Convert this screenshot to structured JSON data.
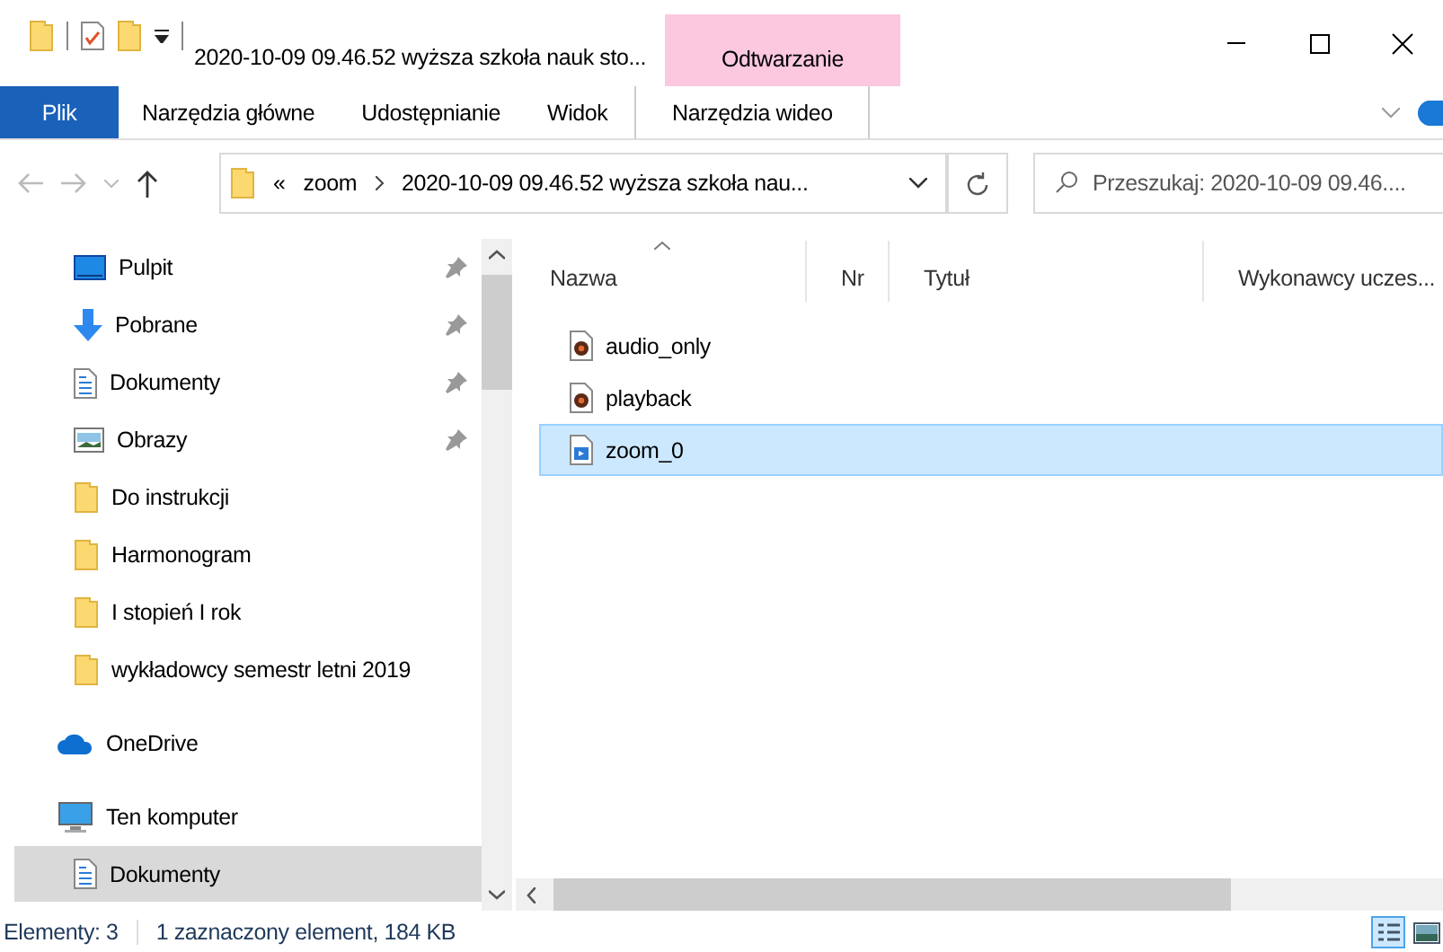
{
  "window": {
    "title": "2020-10-09 09.46.52 wyższa szkoła nauk sto..."
  },
  "contextual_group": {
    "label": "Odtwarzanie"
  },
  "ribbon_tabs": [
    {
      "label": "Plik",
      "kind": "file"
    },
    {
      "label": "Narzędzia główne",
      "kind": "normal"
    },
    {
      "label": "Udostępnianie",
      "kind": "normal"
    },
    {
      "label": "Widok",
      "kind": "normal"
    },
    {
      "label": "Narzędzia wideo",
      "kind": "contextual"
    }
  ],
  "address": {
    "overflow": "«",
    "path": [
      "zoom",
      "2020-10-09 09.46.52 wyższa szkoła nau..."
    ]
  },
  "search": {
    "placeholder": "Przeszukaj: 2020-10-09 09.46...."
  },
  "sidebar": {
    "quick_access": [
      {
        "label": "Pulpit",
        "kind": "desktop",
        "pinned": true
      },
      {
        "label": "Pobrane",
        "kind": "download",
        "pinned": true
      },
      {
        "label": "Dokumenty",
        "kind": "document",
        "pinned": true
      },
      {
        "label": "Obrazy",
        "kind": "pictures",
        "pinned": true
      },
      {
        "label": "Do instrukcji",
        "kind": "folder",
        "pinned": false
      },
      {
        "label": "Harmonogram",
        "kind": "folder",
        "pinned": false
      },
      {
        "label": "I stopień I rok",
        "kind": "folder",
        "pinned": false
      },
      {
        "label": "wykładowcy semestr letni 2019",
        "kind": "folder",
        "pinned": false
      }
    ],
    "items": [
      {
        "label": "OneDrive",
        "kind": "cloud",
        "selected": false
      },
      {
        "label": "Ten komputer",
        "kind": "computer",
        "selected": false,
        "children": [
          {
            "label": "Dokumenty",
            "kind": "document",
            "selected": true
          }
        ]
      }
    ]
  },
  "table": {
    "columns": [
      {
        "label": "Nazwa",
        "sorted": true
      },
      {
        "label": "Nr",
        "sorted": false
      },
      {
        "label": "Tytuł",
        "sorted": false
      },
      {
        "label": "Wykonawcy uczes...",
        "sorted": false
      }
    ],
    "rows": [
      {
        "name": "audio_only",
        "kind": "audio",
        "selected": false
      },
      {
        "name": "playback",
        "kind": "audio",
        "selected": false
      },
      {
        "name": "zoom_0",
        "kind": "video",
        "selected": true
      }
    ]
  },
  "status_bar": {
    "count": "Elementy: 3",
    "selection": "1 zaznaczony element, 184 KB",
    "views": [
      {
        "kind": "details",
        "selected": true
      },
      {
        "kind": "thumbnails",
        "selected": false
      }
    ]
  }
}
